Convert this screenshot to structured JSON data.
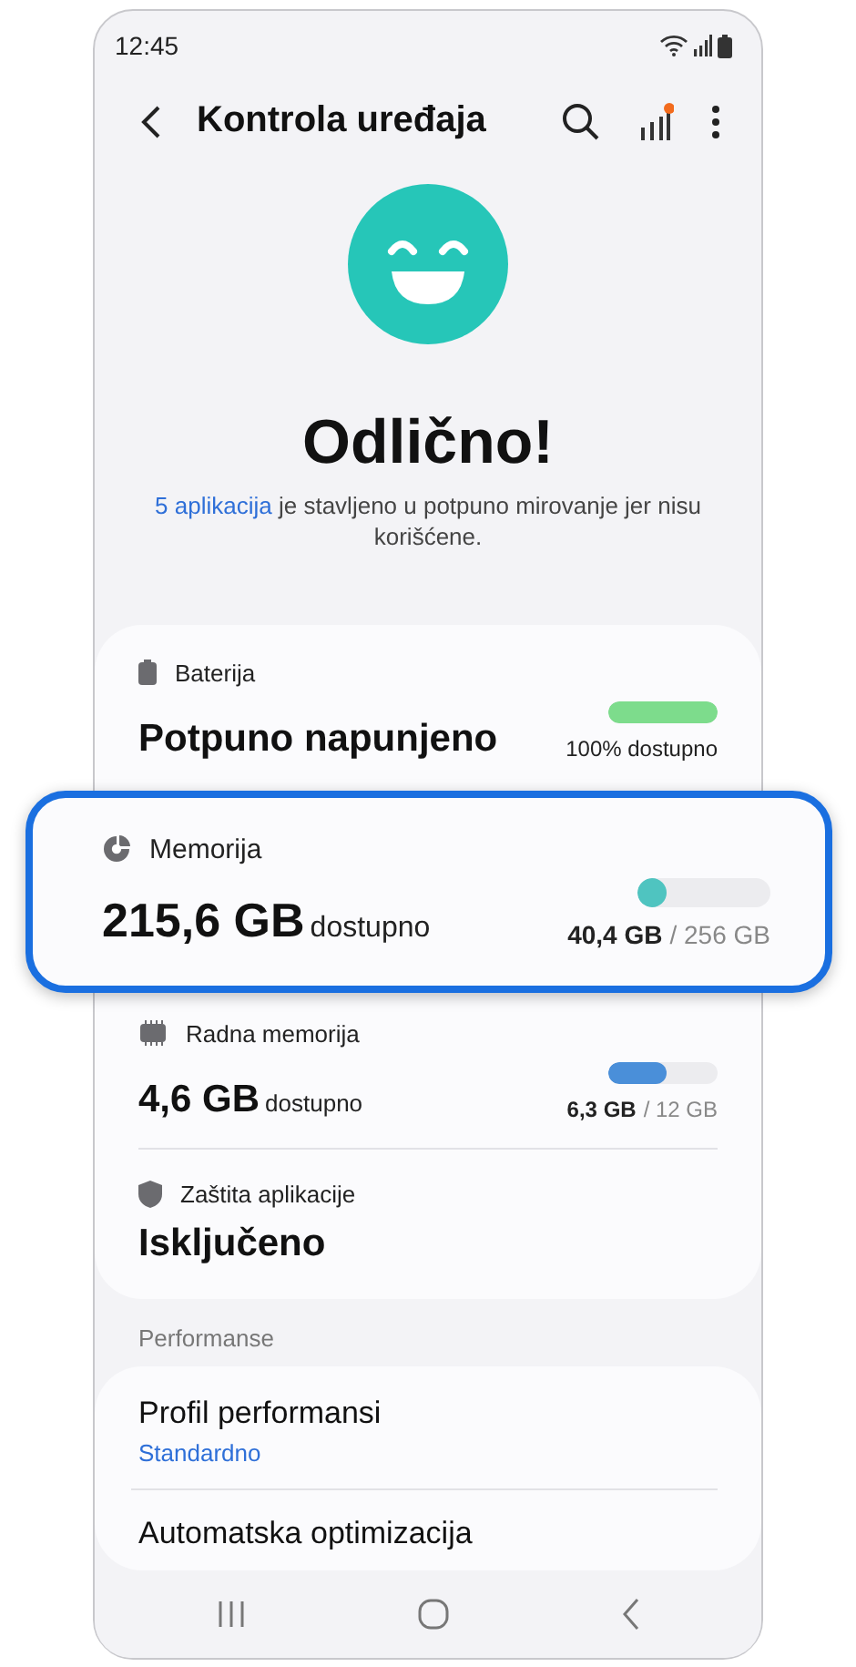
{
  "status_bar": {
    "time": "12:45"
  },
  "header": {
    "title": "Kontrola uređaja"
  },
  "summary": {
    "status": "Odlično!",
    "message_link": "5 aplikacija",
    "message_text": "je stavljeno u potpuno mirovanje jer nisu korišćene."
  },
  "stats": [
    {
      "kind": "battery",
      "label": "Baterija",
      "value": "Potpuno napunjeno",
      "level": 1.0,
      "color": "#7ddc8c",
      "reading": "100% dostupno",
      "highlighted": false
    },
    {
      "kind": "storage",
      "label": "Memorija",
      "value": "215,6 GB",
      "unit": "dostupno",
      "level": 0.16,
      "color": "#4fc4c0",
      "used": "40,4 GB",
      "total": "/ 256 GB",
      "highlighted": true
    },
    {
      "kind": "ram",
      "label": "Radna memorija",
      "value": "4,6 GB",
      "unit": "dostupno",
      "level": 0.53,
      "color": "#4a8fd9",
      "used": "6,3 GB",
      "total": "/ 12 GB",
      "highlighted": false
    },
    {
      "kind": "protection",
      "label": "Zaštita aplikacije",
      "value": "Isključeno",
      "highlighted": false
    }
  ],
  "performance": {
    "heading": "Performanse",
    "items": [
      {
        "title": "Profil performansi",
        "value": "Standardno"
      },
      {
        "title": "Automatska optimizacija"
      }
    ]
  }
}
